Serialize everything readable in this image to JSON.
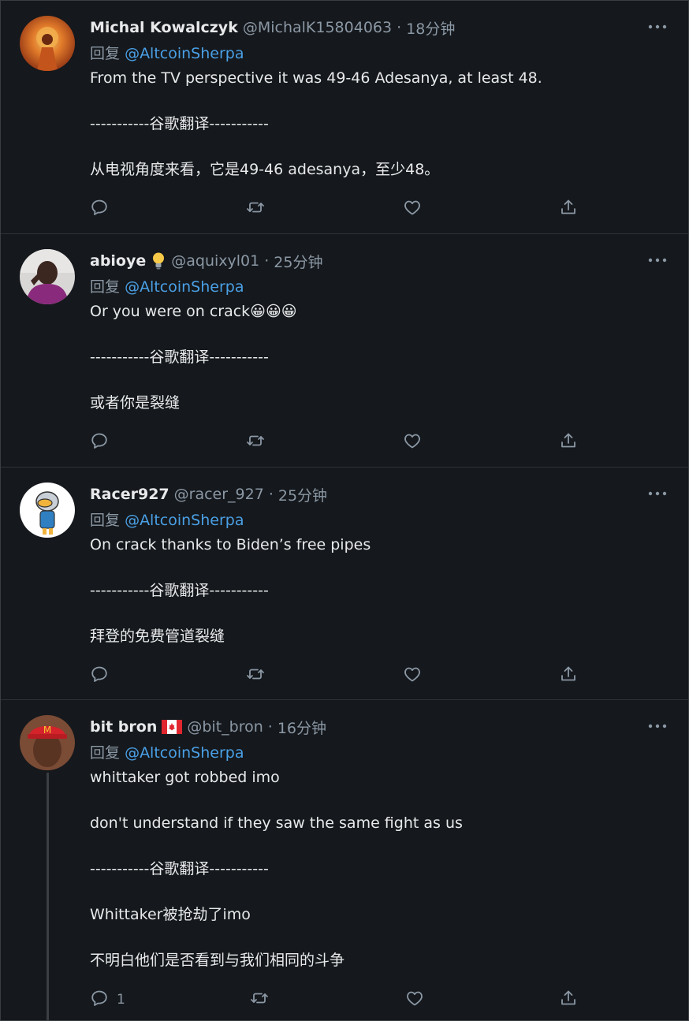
{
  "colors": {
    "background": "#15181c",
    "mention": "#4aa0e6",
    "muted": "#8b98a5"
  },
  "tweets": [
    {
      "name": "Michal Kowalczyk",
      "badge": "",
      "handle": "@MichalK15804063",
      "time": "18分钟",
      "reply_prefix": "回复",
      "reply_mention": "@AltcoinSherpa",
      "text": "From the TV perspective it was 49-46 Adesanya, at least 48.\n\n-----------谷歌翻译-----------\n\n从电视角度来看，它是49-46 adesanya，至少48。",
      "reply_count": ""
    },
    {
      "name": "abioye",
      "badge": "lightbulb-emoji",
      "handle": "@aquixyl01",
      "time": "25分钟",
      "reply_prefix": "回复",
      "reply_mention": "@AltcoinSherpa",
      "text": "Or you were on crack😀😀😀\n\n-----------谷歌翻译-----------\n\n或者你是裂缝",
      "reply_count": ""
    },
    {
      "name": "Racer927",
      "badge": "",
      "handle": "@racer_927",
      "time": "25分钟",
      "reply_prefix": "回复",
      "reply_mention": "@AltcoinSherpa",
      "text": "On crack thanks to Biden’s free pipes\n\n-----------谷歌翻译-----------\n\n拜登的免费管道裂缝",
      "reply_count": ""
    },
    {
      "name": "bit bron",
      "badge": "canada-flag-emoji",
      "handle": "@bit_bron",
      "time": "16分钟",
      "reply_prefix": "回复",
      "reply_mention": "@AltcoinSherpa",
      "text": "whittaker got robbed imo\n\ndon't understand if they saw the same fight as us\n\n-----------谷歌翻译-----------\n\nWhittaker被抢劫了imo\n\n不明白他们是否看到与我们相同的斗争",
      "reply_count": "1"
    }
  ]
}
